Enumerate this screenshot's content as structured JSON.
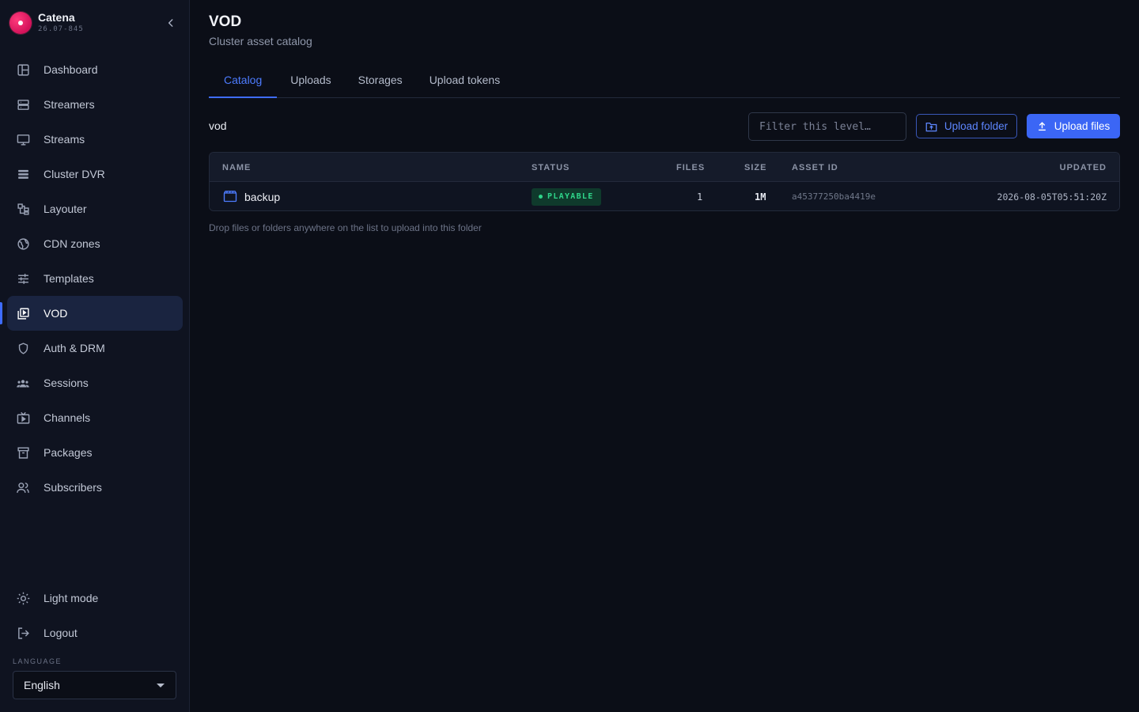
{
  "brand": {
    "name": "Catena",
    "version": "26.07-845"
  },
  "nav": [
    {
      "label": "Dashboard",
      "icon": "dashboard-icon"
    },
    {
      "label": "Streamers",
      "icon": "server-icon"
    },
    {
      "label": "Streams",
      "icon": "monitor-icon"
    },
    {
      "label": "Cluster DVR",
      "icon": "storage-icon"
    },
    {
      "label": "Layouter",
      "icon": "layout-icon"
    },
    {
      "label": "CDN zones",
      "icon": "globe-icon"
    },
    {
      "label": "Templates",
      "icon": "sliders-icon"
    },
    {
      "label": "VOD",
      "icon": "video-library-icon",
      "active": true
    },
    {
      "label": "Auth & DRM",
      "icon": "shield-icon"
    },
    {
      "label": "Sessions",
      "icon": "users-icon"
    },
    {
      "label": "Channels",
      "icon": "tv-icon"
    },
    {
      "label": "Packages",
      "icon": "archive-icon"
    },
    {
      "label": "Subscribers",
      "icon": "user-group-icon"
    }
  ],
  "bottom_nav": [
    {
      "label": "Light mode",
      "icon": "sun-icon"
    },
    {
      "label": "Logout",
      "icon": "logout-icon"
    }
  ],
  "language": {
    "label": "LANGUAGE",
    "selected": "English"
  },
  "page": {
    "title": "VOD",
    "subtitle": "Cluster asset catalog"
  },
  "tabs": [
    {
      "label": "Catalog",
      "active": true
    },
    {
      "label": "Uploads"
    },
    {
      "label": "Storages"
    },
    {
      "label": "Upload tokens"
    }
  ],
  "toolbar": {
    "path": "vod",
    "filter_placeholder": "Filter this level…",
    "upload_folder": "Upload folder",
    "upload_files": "Upload files"
  },
  "table": {
    "headers": {
      "name": "NAME",
      "status": "STATUS",
      "files": "FILES",
      "size": "SIZE",
      "asset_id": "ASSET ID",
      "updated": "UPDATED"
    },
    "rows": [
      {
        "name": "backup",
        "status": "PLAYABLE",
        "files": "1",
        "size": "1M",
        "asset_id": "a45377250ba4419e",
        "updated": "2026-08-05T05:51:20Z"
      }
    ]
  },
  "hint": "Drop files or folders anywhere on the list to upload into this folder",
  "colors": {
    "accent": "#3b66f5",
    "status_ok": "#2fd58a",
    "brand": "#e0195f"
  }
}
